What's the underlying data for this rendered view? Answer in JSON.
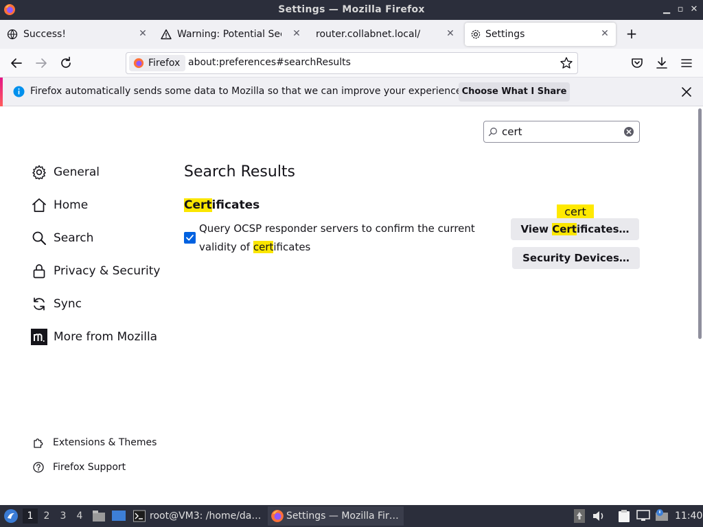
{
  "window": {
    "title": "Settings — Mozilla Firefox"
  },
  "tabs": [
    {
      "label": "Success!",
      "icon": "globe-icon"
    },
    {
      "label": "Warning: Potential Securi",
      "icon": "warning-icon"
    },
    {
      "label": "router.collabnet.local/",
      "icon": "none"
    },
    {
      "label": "Settings",
      "icon": "gear-icon",
      "active": true
    }
  ],
  "navbar": {
    "identity_label": "Firefox",
    "url": "about:preferences#searchResults"
  },
  "notification": {
    "message": "Firefox automatically sends some data to Mozilla so that we can improve your experience.",
    "button_label": "Choose What I Share"
  },
  "search": {
    "value": "cert"
  },
  "categories": [
    {
      "label": "General",
      "icon": "gear-icon"
    },
    {
      "label": "Home",
      "icon": "home-icon"
    },
    {
      "label": "Search",
      "icon": "search-icon"
    },
    {
      "label": "Privacy & Security",
      "icon": "lock-icon"
    },
    {
      "label": "Sync",
      "icon": "sync-icon"
    },
    {
      "label": "More from Mozilla",
      "icon": "mozilla-icon"
    }
  ],
  "footer_links": [
    {
      "label": "Extensions & Themes",
      "icon": "puzzle-icon"
    },
    {
      "label": "Firefox Support",
      "icon": "help-icon"
    }
  ],
  "results": {
    "title": "Search Results",
    "group_title_hl": "Cert",
    "group_title_rest": "ificates",
    "checkbox_checked": true,
    "pref_line1": "Query OCSP responder servers to confirm the current",
    "pref_line2_pre": "validity of ",
    "pref_line2_hl": "cert",
    "pref_line2_post": "ificates",
    "tooltip": "cert",
    "view_btn_pre": "View ",
    "view_btn_hl": "Cert",
    "view_btn_post": "ificates…",
    "devices_btn": "Security Devices…"
  },
  "taskbar": {
    "workspaces": [
      "1",
      "2",
      "3",
      "4"
    ],
    "active_workspace": "1",
    "tasks": [
      {
        "label": "root@VM3: /home/da…",
        "icon": "terminal-icon"
      },
      {
        "label": "Settings — Mozilla Fir…",
        "icon": "firefox-icon",
        "active": true
      }
    ],
    "clock": "11:40"
  },
  "colors": {
    "accent_blue": "#0061e0",
    "highlight_yellow": "#fbe600",
    "titlebar": "#2b2e3b"
  }
}
